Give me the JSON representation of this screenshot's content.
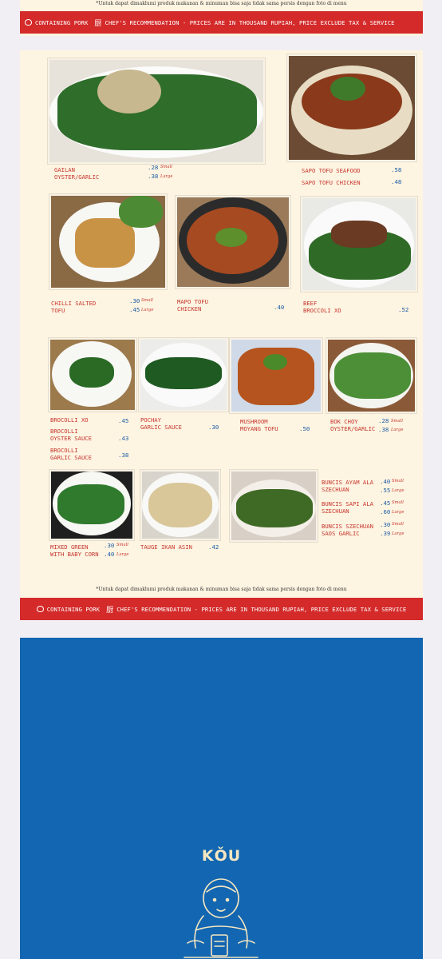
{
  "top_note": "*Untuk dapat dimaklumi produk makanan & minuman bisa saja tidak sama persis dengan foto di menu",
  "banner": {
    "pork": "CONTAINING PORK",
    "chef_symbol": "厨",
    "text": "CHEF'S RECOMMENDATION - PRICES ARE IN THOUSAND RUPIAH, PRICE EXCLUDE TAX & SERVICE"
  },
  "sizes": {
    "small": "Small",
    "large": "Large"
  },
  "items": {
    "gailan": {
      "name": "GAILAN\nOYSTER/GARLIC",
      "price_small": "28",
      "price_large": "38"
    },
    "sapo_tofu_seafood": {
      "name": "SAPO TOFU SEAFOOD",
      "price": "58"
    },
    "sapo_tofu_chicken": {
      "name": "SAPO TOFU CHICKEN",
      "price": "48"
    },
    "chilli_salted_tofu": {
      "name": "CHILLI SALTED\nTOFU",
      "price_small": "30",
      "price_large": "45"
    },
    "mapo_tofu_chicken": {
      "name": "MAPO TOFU\nCHICKEN",
      "price": "40"
    },
    "beef_broccoli_xo": {
      "name": "BEEF\nBROCCOLI XO",
      "price": "52"
    },
    "brocolli_xo": {
      "name": "BROCOLLI  XO",
      "price": "45"
    },
    "brocolli_oyster": {
      "name": "BROCOLLI\nOYSTER SAUCE",
      "price": "43"
    },
    "brocolli_garlic": {
      "name": "BROCOLLI\nGARLIC SAUCE",
      "price": "38"
    },
    "pochay": {
      "name": "POCHAY\nGARLIC SAUCE",
      "price": "30"
    },
    "mushroom_moyang_tofu": {
      "name": "MUSHROOM\nMOYANG TOFU",
      "price": "50"
    },
    "bok_choy": {
      "name": "BOK CHOY\nOYSTER/GARLIC",
      "price_small": "28",
      "price_large": "38"
    },
    "mixed_green": {
      "name": "MIXED GREEN\nWITH BABY CORN",
      "price_small": "30",
      "price_large": "40"
    },
    "tauge_ikan_asin": {
      "name": "TAUGE IKAN ASIN",
      "price": "42"
    },
    "buncis_ayam": {
      "name": "BUNCIS AYAM ALA\nSZECHUAN",
      "price_small": "40",
      "price_large": "55"
    },
    "buncis_sapi": {
      "name": "BUNCIS SAPI ALA\nSZECHUAN",
      "price_small": "45",
      "price_large": "60"
    },
    "buncis_szechuan": {
      "name": "BUNCIS SZECHUAN\nSAOS GARLIC",
      "price_small": "30",
      "price_large": "39"
    }
  },
  "price_prefix": ".",
  "brand": {
    "name": "KǑU"
  },
  "colors": {
    "banner": "#d42a2a",
    "paper": "#fdf4e1",
    "price_blue": "#1f5ea6",
    "label_red": "#c7352e",
    "brand_blue": "#1366b1"
  }
}
